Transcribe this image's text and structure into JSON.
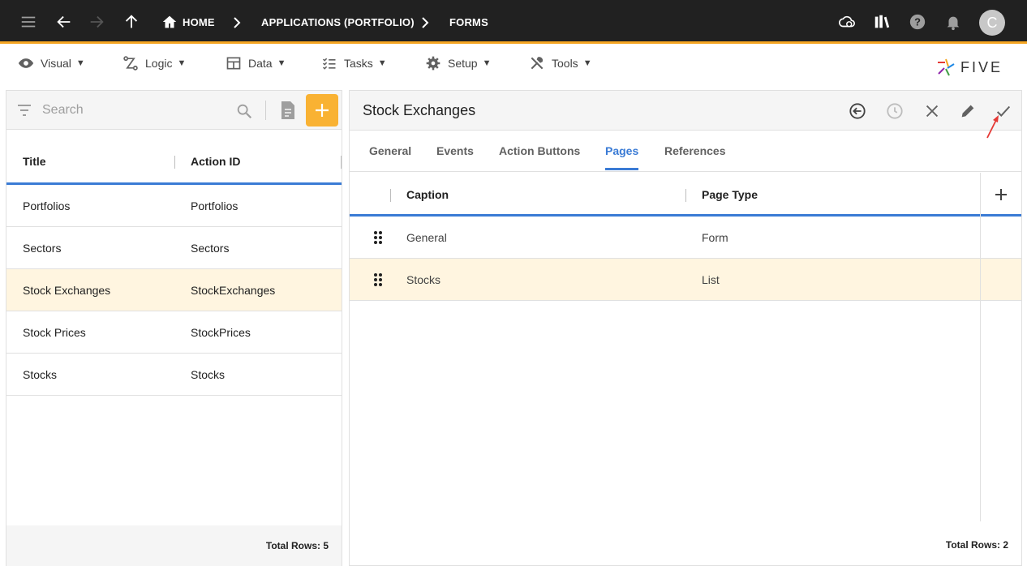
{
  "topbar": {
    "breadcrumbs": [
      "HOME",
      "APPLICATIONS (PORTFOLIO)",
      "FORMS"
    ],
    "avatar_letter": "C"
  },
  "menu": {
    "items": [
      {
        "label": "Visual",
        "icon": "eye-icon"
      },
      {
        "label": "Logic",
        "icon": "logic-icon"
      },
      {
        "label": "Data",
        "icon": "table-icon"
      },
      {
        "label": "Tasks",
        "icon": "tasks-icon"
      },
      {
        "label": "Setup",
        "icon": "gear-icon"
      },
      {
        "label": "Tools",
        "icon": "tools-icon"
      }
    ],
    "caret": "▼",
    "logo_text": "FIVE"
  },
  "left": {
    "search_placeholder": "Search",
    "columns": [
      "Title",
      "Action ID"
    ],
    "rows": [
      {
        "title": "Portfolios",
        "action_id": "Portfolios"
      },
      {
        "title": "Sectors",
        "action_id": "Sectors"
      },
      {
        "title": "Stock Exchanges",
        "action_id": "StockExchanges"
      },
      {
        "title": "Stock Prices",
        "action_id": "StockPrices"
      },
      {
        "title": "Stocks",
        "action_id": "Stocks"
      }
    ],
    "total": "Total Rows: 5"
  },
  "form": {
    "title": "Stock Exchanges",
    "tabs": [
      "General",
      "Events",
      "Action Buttons",
      "Pages",
      "References"
    ],
    "active_tab": "Pages",
    "columns": [
      "Caption",
      "Page Type"
    ],
    "rows": [
      {
        "caption": "General",
        "page_type": "Form"
      },
      {
        "caption": "Stocks",
        "page_type": "List"
      }
    ],
    "total": "Total Rows: 2"
  },
  "colors": {
    "topbar": "#212121",
    "accent": "#f5a623",
    "add_button": "#f9b233",
    "active_blue": "#3a7bd5",
    "selected_row": "#fff5e0",
    "annotation_arrow": "#e53935"
  }
}
